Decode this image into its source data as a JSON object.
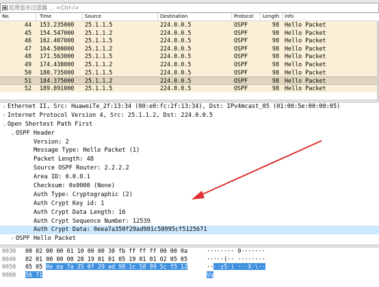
{
  "filter": {
    "placeholder": "应用显示过滤器 … <Ctrl-/>",
    "icon": "bookmark-icon"
  },
  "columns": [
    "No.",
    "Time",
    "Source",
    "Destination",
    "Protocol",
    "Length",
    "Info"
  ],
  "packets": [
    {
      "no": "44",
      "time": "153.235000",
      "src": "25.1.1.5",
      "dst": "224.0.0.5",
      "proto": "OSPF",
      "len": "98",
      "info": "Hello Packet"
    },
    {
      "no": "45",
      "time": "154.547000",
      "src": "25.1.1.2",
      "dst": "224.0.0.5",
      "proto": "OSPF",
      "len": "98",
      "info": "Hello Packet"
    },
    {
      "no": "46",
      "time": "162.407000",
      "src": "25.1.1.5",
      "dst": "224.0.0.5",
      "proto": "OSPF",
      "len": "98",
      "info": "Hello Packet"
    },
    {
      "no": "47",
      "time": "164.500000",
      "src": "25.1.1.2",
      "dst": "224.0.0.5",
      "proto": "OSPF",
      "len": "98",
      "info": "Hello Packet"
    },
    {
      "no": "48",
      "time": "171.563000",
      "src": "25.1.1.5",
      "dst": "224.0.0.5",
      "proto": "OSPF",
      "len": "98",
      "info": "Hello Packet"
    },
    {
      "no": "49",
      "time": "174.438000",
      "src": "25.1.1.2",
      "dst": "224.0.0.5",
      "proto": "OSPF",
      "len": "98",
      "info": "Hello Packet"
    },
    {
      "no": "50",
      "time": "180.735000",
      "src": "25.1.1.5",
      "dst": "224.0.0.5",
      "proto": "OSPF",
      "len": "98",
      "info": "Hello Packet"
    },
    {
      "no": "51",
      "time": "184.375000",
      "src": "25.1.1.2",
      "dst": "224.0.0.5",
      "proto": "OSPF",
      "len": "98",
      "info": "Hello Packet"
    },
    {
      "no": "52",
      "time": "189.891000",
      "src": "25.1.1.5",
      "dst": "224.0.0.5",
      "proto": "OSPF",
      "len": "98",
      "info": "Hello Packet"
    }
  ],
  "selected_packet": "51",
  "details": [
    {
      "toggle": "›",
      "text": "Ethernet II, Src: HuaweiTe_2f:13:34 (00:e0:fc:2f:13:34), Dst: IPv4mcast_05 (01:00:5e:00:00:05)"
    },
    {
      "toggle": "›",
      "text": "Internet Protocol Version 4, Src: 25.1.1.2, Dst: 224.0.0.5"
    },
    {
      "toggle": "⌄",
      "text": "Open Shortest Path First"
    },
    {
      "toggle": "⌄",
      "text": "OSPF Header"
    },
    {
      "toggle": "",
      "text": "Version: 2"
    },
    {
      "toggle": "",
      "text": "Message Type: Hello Packet (1)"
    },
    {
      "toggle": "",
      "text": "Packet Length: 48"
    },
    {
      "toggle": "",
      "text": "Source OSPF Router: 2.2.2.2"
    },
    {
      "toggle": "",
      "text": "Area ID: 0.0.0.1"
    },
    {
      "toggle": "",
      "text": "Checksum: 0x0000 (None)"
    },
    {
      "toggle": "",
      "text": "Auth Type: Cryptographic (2)"
    },
    {
      "toggle": "",
      "text": "Auth Crypt Key id: 1"
    },
    {
      "toggle": "",
      "text": "Auth Crypt Data Length: 16"
    },
    {
      "toggle": "",
      "text": "Auth Crypt Sequence Number: 12539"
    },
    {
      "toggle": "",
      "text": "Auth Crypt Data: 0eea7a350f29ad981c58995cf5125671"
    },
    {
      "toggle": "›",
      "text": "OSPF Hello Packet"
    }
  ],
  "bytes": [
    {
      "offset": "0030",
      "hex": "00 02 00 00 01 10 00 00  30 fb ff ff ff 00 00 0a",
      "hex_hl": "",
      "ascii": "········ 0·······",
      "ascii_hl": ""
    },
    {
      "offset": "0040",
      "hex": "02 01 00 00 00 28 19 01  01 05 19 01 01 02 05 05",
      "hex_hl": "",
      "ascii": "·····(·· ········",
      "ascii_hl": ""
    },
    {
      "offset": "0050",
      "hex": "05 05 ",
      "hex_hl": "0e ea 7a 35 0f 29  ad 98 1c 58 99 5c f5 12",
      "ascii": "··",
      "ascii_hl": "··z5·) ···X·\\··"
    },
    {
      "offset": "0060",
      "hex": "",
      "hex_hl": "56 71",
      "ascii": "",
      "ascii_hl": "Vq"
    }
  ],
  "colors": {
    "row_bg": "#faf0d7",
    "row_selected_bg": "#e0d6c0",
    "detail_selected_bg": "#cce8ff",
    "byte_highlight": "#3d8fe0",
    "annotation_arrow": "#e03030"
  }
}
